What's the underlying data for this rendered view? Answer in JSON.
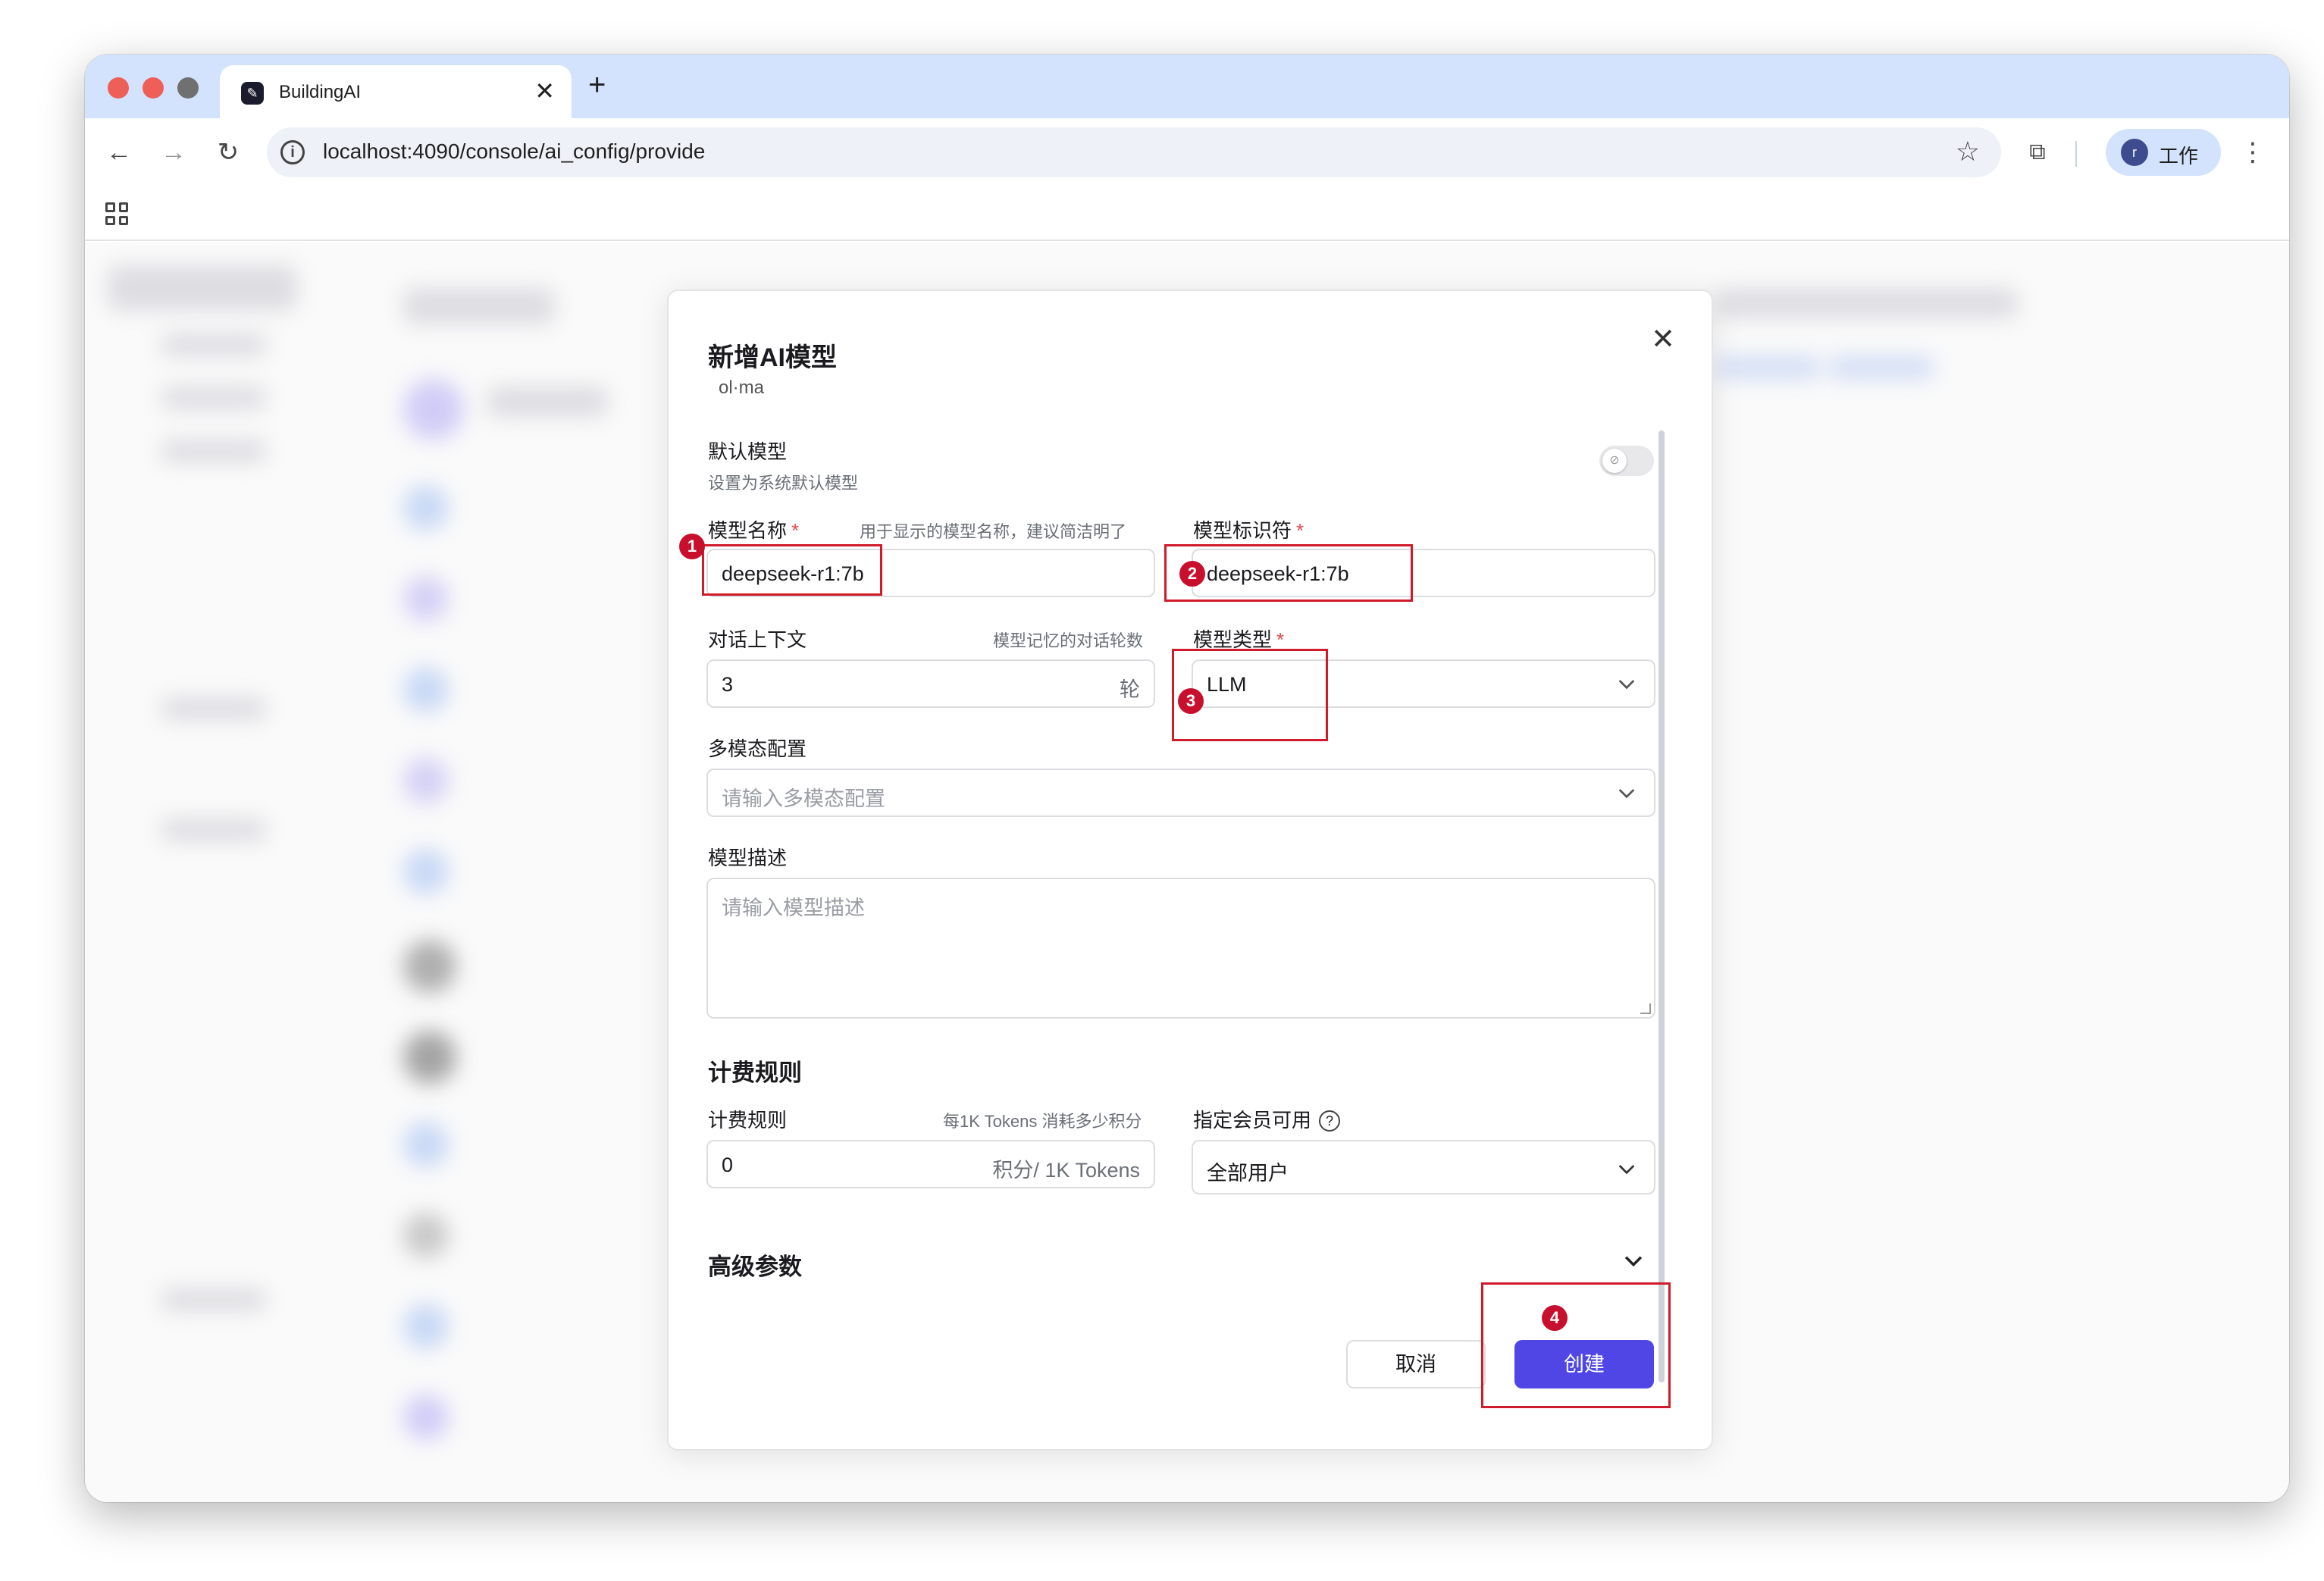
{
  "browser": {
    "tab_title": "BuildingAI",
    "tab_close": "✕",
    "new_tab": "+",
    "url": "localhost:4090/console/ai_config/provide",
    "profile_initial": "r",
    "profile_label": "工作"
  },
  "modal": {
    "title": "新增AI模型",
    "subtitle": "ol·ma",
    "close": "✕",
    "default_model": {
      "label": "默认模型",
      "hint": "设置为系统默认模型",
      "enabled": false
    },
    "model_name": {
      "label": "模型名称",
      "required": "*",
      "hint": "用于显示的模型名称，建议简洁明了",
      "value": "deepseek-r1:7b"
    },
    "model_id": {
      "label": "模型标识符",
      "required": "*",
      "value": "deepseek-r1:7b"
    },
    "context": {
      "label": "对话上下文",
      "hint": "模型记忆的对话轮数",
      "value": "3",
      "suffix": "轮"
    },
    "model_type": {
      "label": "模型类型",
      "required": "*",
      "value": "LLM"
    },
    "multimodal": {
      "label": "多模态配置",
      "placeholder": "请输入多模态配置"
    },
    "description": {
      "label": "模型描述",
      "placeholder": "请输入模型描述"
    },
    "billing": {
      "section_title": "计费规则",
      "label": "计费规则",
      "hint": "每1K Tokens 消耗多少积分",
      "value": "0",
      "suffix": "积分/ 1K Tokens"
    },
    "membership": {
      "label": "指定会员可用",
      "help": "?",
      "value": "全部用户"
    },
    "advanced": {
      "title": "高级参数"
    },
    "buttons": {
      "cancel": "取消",
      "create": "创建"
    }
  },
  "annotations": [
    "1",
    "2",
    "3",
    "4"
  ],
  "colors": {
    "primary": "#4f46e5",
    "annotation": "#d11a2a",
    "required": "#e5484d",
    "tab_strip": "#d3e3fd"
  }
}
